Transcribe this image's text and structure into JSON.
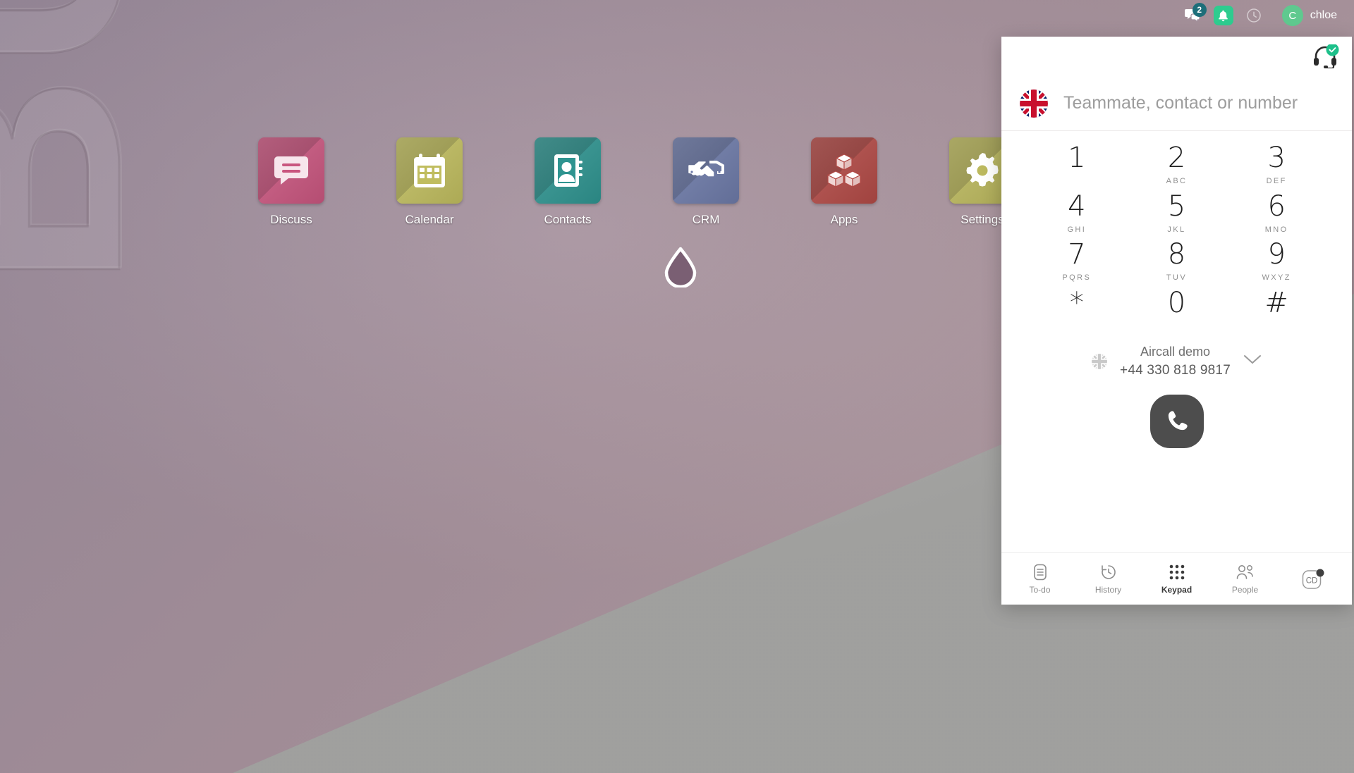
{
  "topbar": {
    "messages": {
      "icon": "chat-bubbles-icon",
      "badge": "2"
    },
    "activities": {
      "icon": "bell-icon"
    },
    "help": {
      "icon": "clock-icon"
    },
    "user": {
      "avatar_initial": "C",
      "name": "chloe"
    }
  },
  "wallpaper": {
    "watermark_text": "BUG",
    "primary_color": "#a2909c",
    "secondary_color": "#a8a8a6"
  },
  "desktop": {
    "apps": [
      {
        "label": "Discuss",
        "icon": "discuss-chat-icon",
        "color": "#c9567f"
      },
      {
        "label": "Calendar",
        "icon": "calendar-icon",
        "color": "#c0bd5f"
      },
      {
        "label": "Contacts",
        "icon": "contacts-book-icon",
        "color": "#2f9490"
      },
      {
        "label": "CRM",
        "icon": "handshake-icon",
        "color": "#6d7aa8"
      },
      {
        "label": "Apps",
        "icon": "boxes-icon",
        "color": "#b24a46"
      },
      {
        "label": "Settings",
        "icon": "gear-icon",
        "color": "#bcb95e"
      }
    ],
    "droplet": {
      "icon": "water-droplet-icon"
    }
  },
  "dialer": {
    "status": {
      "icon": "headset-icon",
      "state": "available",
      "state_color": "#1dc08a"
    },
    "search": {
      "flag": "uk-flag-icon",
      "placeholder": "Teammate, contact or number",
      "value": ""
    },
    "keypad": [
      {
        "digit": "1",
        "letters": ""
      },
      {
        "digit": "2",
        "letters": "ABC"
      },
      {
        "digit": "3",
        "letters": "DEF"
      },
      {
        "digit": "4",
        "letters": "GHI"
      },
      {
        "digit": "5",
        "letters": "JKL"
      },
      {
        "digit": "6",
        "letters": "MNO"
      },
      {
        "digit": "7",
        "letters": "PQRS"
      },
      {
        "digit": "8",
        "letters": "TUV"
      },
      {
        "digit": "9",
        "letters": "WXYZ"
      },
      {
        "digit": "*",
        "letters": ""
      },
      {
        "digit": "0",
        "letters": ""
      },
      {
        "digit": "#",
        "letters": ""
      }
    ],
    "caller_id": {
      "flag": "uk-flag-icon",
      "name": "Aircall demo",
      "number": "+44 330 818 9817",
      "chevron": "chevron-down-icon"
    },
    "call_button": {
      "icon": "phone-icon",
      "color": "#4d4d4d"
    },
    "nav": [
      {
        "label": "To-do",
        "icon": "list-document-icon",
        "active": false
      },
      {
        "label": "History",
        "icon": "history-clock-icon",
        "active": false
      },
      {
        "label": "Keypad",
        "icon": "keypad-dots-icon",
        "active": true
      },
      {
        "label": "People",
        "icon": "people-icon",
        "active": false
      },
      {
        "label": "CD",
        "icon": "cd-avatar-icon",
        "active": false
      }
    ]
  }
}
